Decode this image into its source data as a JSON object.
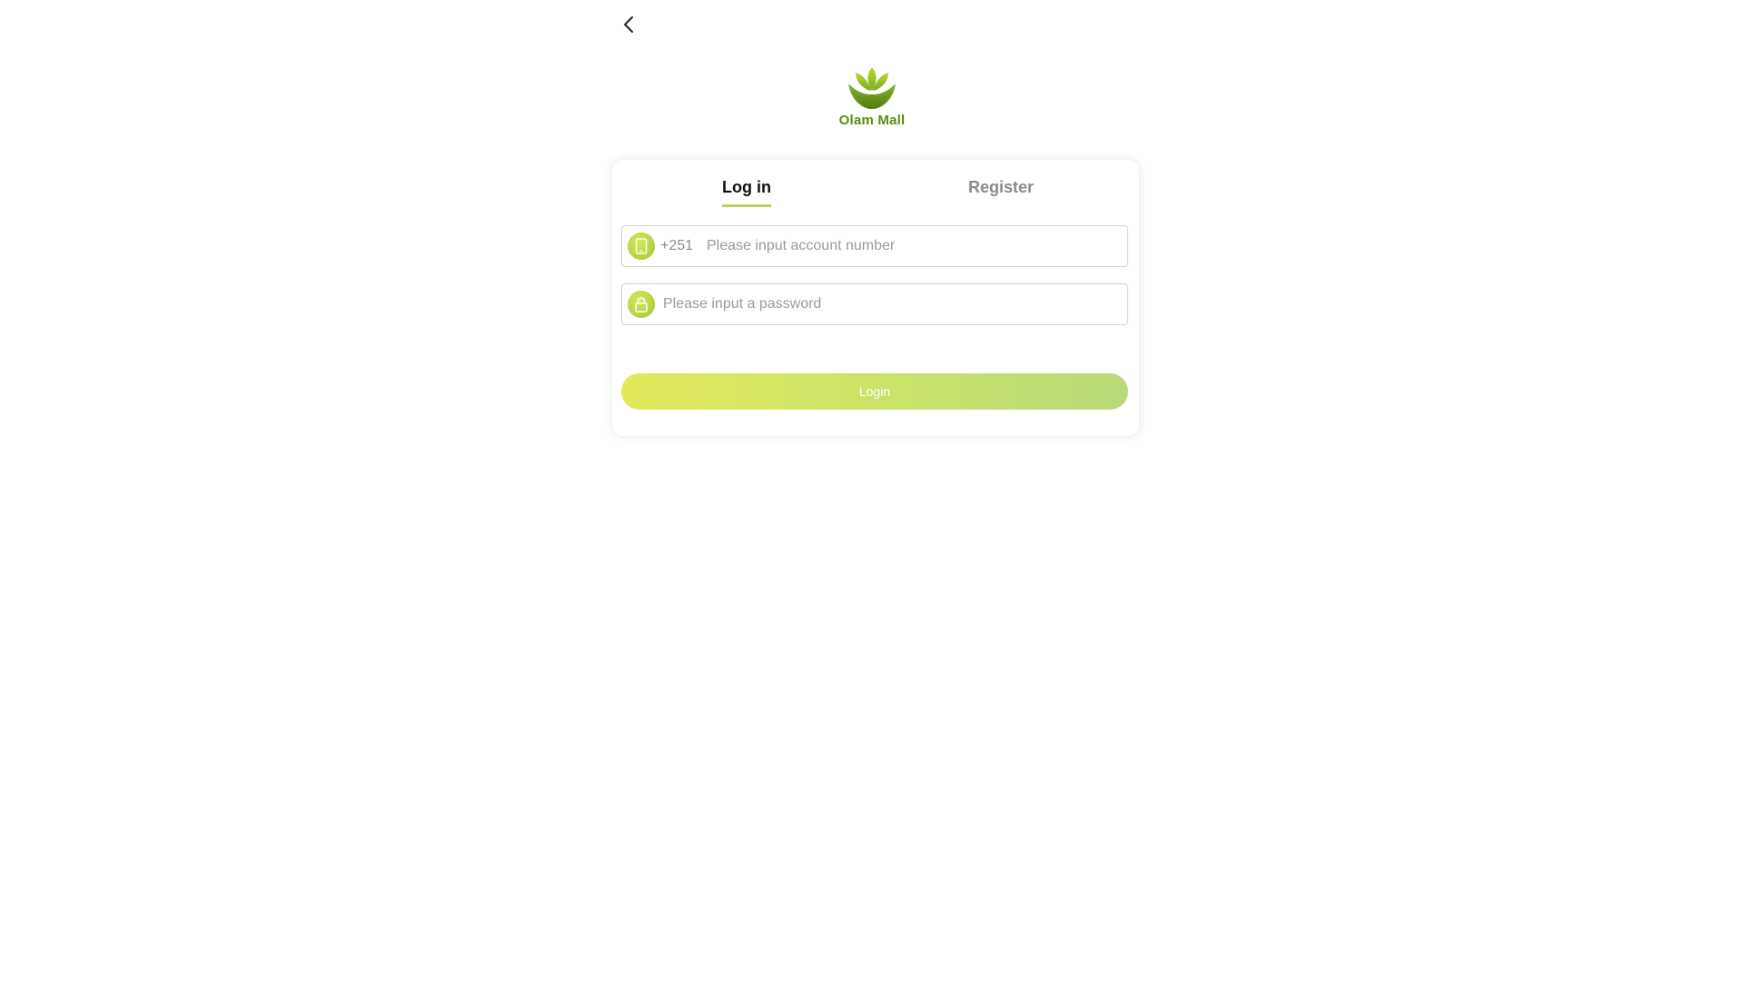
{
  "brand": {
    "name": "Olam Mall",
    "logo_icon": "leaf-logo-icon",
    "color": "#5c8a12"
  },
  "nav": {
    "back_icon": "chevron-left-icon"
  },
  "tabs": [
    {
      "label": "Log in",
      "active": true
    },
    {
      "label": "Register",
      "active": false
    }
  ],
  "form": {
    "phone": {
      "icon": "phone-icon",
      "prefix": "+251",
      "placeholder": "Please input account number",
      "value": ""
    },
    "password": {
      "icon": "lock-icon",
      "placeholder": "Please input a password",
      "value": ""
    },
    "submit_label": "Login"
  },
  "colors": {
    "accent": "#b6d55a",
    "button_gradient_start": "#e2e95a",
    "button_gradient_end": "#b9d97a"
  }
}
